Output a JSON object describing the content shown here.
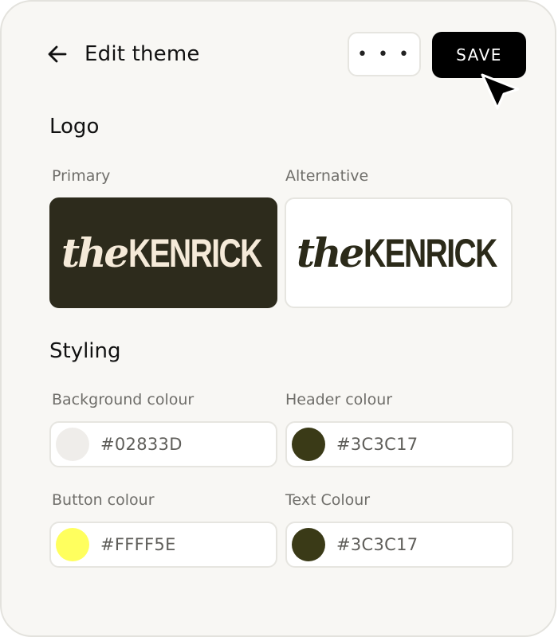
{
  "header": {
    "title": "Edit theme",
    "more_label": "• • •",
    "save_label": "SAVE"
  },
  "logo": {
    "section_title": "Logo",
    "primary_label": "Primary",
    "alternative_label": "Alternative",
    "brand_prefix": "the",
    "brand_name": "KENRICK"
  },
  "styling": {
    "section_title": "Styling",
    "fields": [
      {
        "label": "Background colour",
        "value": "#02833D",
        "swatch": "#efedea"
      },
      {
        "label": "Header colour",
        "value": "#3C3C17",
        "swatch": "#3a3a17"
      },
      {
        "label": "Button colour",
        "value": "#FFFF5E",
        "swatch": "#ffff5e"
      },
      {
        "label": "Text Colour",
        "value": "#3C3C17",
        "swatch": "#3a3a17"
      }
    ]
  },
  "icons": {
    "back": "arrow-left-icon",
    "cursor": "mouse-pointer-icon"
  }
}
